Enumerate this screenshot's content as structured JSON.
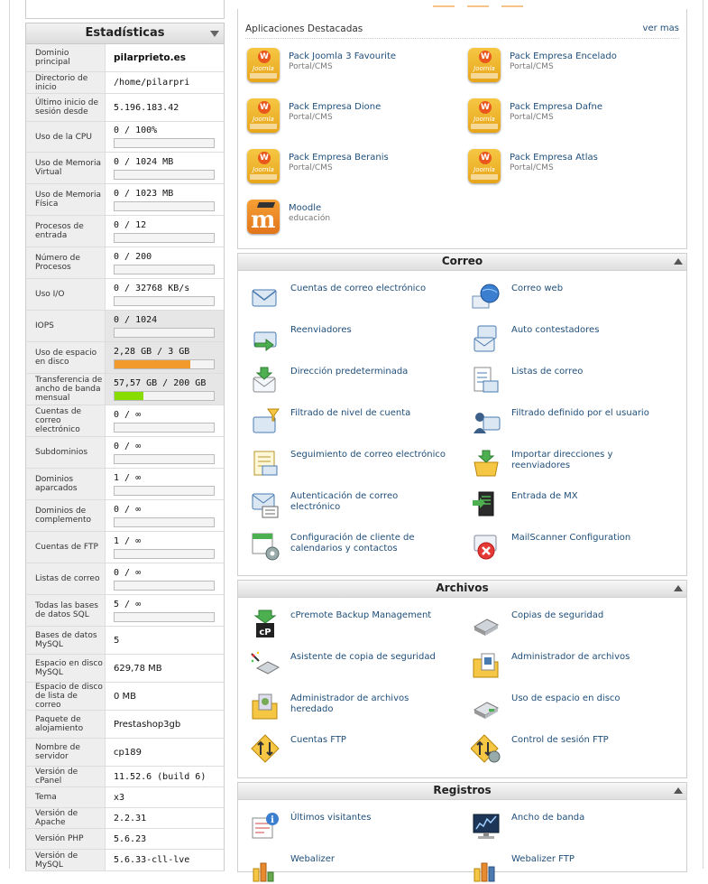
{
  "stats": {
    "title": "Estadísticas",
    "rows": [
      {
        "label": "Dominio principal",
        "value": "pilarprieto.es",
        "bold": true
      },
      {
        "label": "Directorio de inicio",
        "value": "/home/pilarpri"
      },
      {
        "label": "Último inicio de sesión desde",
        "value": "5.196.183.42"
      },
      {
        "label": "Uso de la CPU",
        "value": "0 / 100%",
        "bar": 0
      },
      {
        "label": "Uso de Memoria Virtual",
        "value": "0 / 1024 MB",
        "bar": 0
      },
      {
        "label": "Uso de Memoria Física",
        "value": "0 / 1023 MB",
        "bar": 0
      },
      {
        "label": "Procesos de entrada",
        "value": "0 / 12",
        "bar": 0
      },
      {
        "label": "Número de Procesos",
        "value": "0 / 200",
        "bar": 0
      },
      {
        "label": "Uso I/O",
        "value": "0 / 32768 KB/s",
        "bar": 0
      },
      {
        "label": "IOPS",
        "value": "0 / 1024",
        "bar": 0
      },
      {
        "label": "Uso de espacio en disco",
        "value": "2,28 GB / 3 GB",
        "bar": 0.76,
        "bar_color": "#f39a2c"
      },
      {
        "label": "Transferencia de ancho de banda mensual",
        "value": "57,57 GB / 200 GB",
        "bar": 0.29,
        "bar_color": "#88dd00"
      },
      {
        "label": "Cuentas de correo electrónico",
        "value": "0 / ∞",
        "bar": 0
      },
      {
        "label": "Subdominios",
        "value": "0 / ∞",
        "bar": 0
      },
      {
        "label": "Dominios aparcados",
        "value": "1 / ∞",
        "bar": 0
      },
      {
        "label": "Dominios de complemento",
        "value": "0 / ∞",
        "bar": 0
      },
      {
        "label": "Cuentas de FTP",
        "value": "1 / ∞",
        "bar": 0
      },
      {
        "label": "Listas de correo",
        "value": "0 / ∞",
        "bar": 0
      },
      {
        "label": "Todas las bases de datos SQL",
        "value": "5 / ∞",
        "bar": 0
      },
      {
        "label": "Bases de datos MySQL",
        "value": "5",
        "sans": true
      },
      {
        "label": "Espacio en disco MySQL",
        "value": "629,78 MB",
        "sans": true
      },
      {
        "label": "Espacio de disco de lista de correo",
        "value": "0 MB",
        "sans": true
      },
      {
        "label": "Paquete de alojamiento",
        "value": "Prestashop3gb",
        "sans": true
      },
      {
        "label": "Nombre de servidor",
        "value": "cp189",
        "sans": true
      },
      {
        "label": "Versión de cPanel",
        "value": "11.52.6 (build 6)"
      },
      {
        "label": "Tema",
        "value": "x3"
      },
      {
        "label": "Versión de Apache",
        "value": "2.2.31"
      },
      {
        "label": "Versión PHP",
        "value": "5.6.23"
      },
      {
        "label": "Versión de MySQL",
        "value": "5.6.33-cll-lve"
      }
    ]
  },
  "featured": {
    "title": "Aplicaciones Destacadas",
    "more": "ver mas",
    "joomla_badge": "W",
    "joomla_text": "Joomla",
    "moodle_letter": "m",
    "items": [
      {
        "name": "Pack Joomla 3 Favourite",
        "sub": "Portal/CMS",
        "icon": "joomla-pack-icon"
      },
      {
        "name": "Pack Empresa Encelado",
        "sub": "Portal/CMS",
        "icon": "joomla-pack-icon"
      },
      {
        "name": "Pack Empresa Dione",
        "sub": "Portal/CMS",
        "icon": "joomla-pack-icon"
      },
      {
        "name": "Pack Empresa Dafne",
        "sub": "Portal/CMS",
        "icon": "joomla-pack-icon"
      },
      {
        "name": "Pack Empresa Beranis",
        "sub": "Portal/CMS",
        "icon": "joomla-pack-icon"
      },
      {
        "name": "Pack Empresa Atlas",
        "sub": "Portal/CMS",
        "icon": "joomla-pack-icon"
      },
      {
        "name": "Moodle",
        "sub": "educación",
        "icon": "moodle-icon"
      }
    ]
  },
  "correo": {
    "title": "Correo",
    "items": [
      {
        "label": "Cuentas de correo electrónico",
        "icon": "envelope-icon"
      },
      {
        "label": "Correo web",
        "icon": "webmail-globe-icon"
      },
      {
        "label": "Reenviadores",
        "icon": "forward-mail-icon"
      },
      {
        "label": "Auto contestadores",
        "icon": "autoresponder-icon"
      },
      {
        "label": "Dirección predeterminada",
        "icon": "default-address-icon"
      },
      {
        "label": "Listas de correo",
        "icon": "mailing-list-icon"
      },
      {
        "label": "Filtrado de nivel de cuenta",
        "icon": "account-filter-icon"
      },
      {
        "label": "Filtrado definido por el usuario",
        "icon": "user-filter-icon"
      },
      {
        "label": "Seguimiento de correo electrónico",
        "icon": "email-trace-icon"
      },
      {
        "label": "Importar direcciones y reenviadores",
        "icon": "import-icon"
      },
      {
        "label": "Autenticación de correo electrónico",
        "icon": "email-auth-icon"
      },
      {
        "label": "Entrada de MX",
        "icon": "mx-entry-icon"
      },
      {
        "label": "Configuración de cliente de calendarios y contactos",
        "icon": "calendar-config-icon"
      },
      {
        "label": "MailScanner Configuration",
        "icon": "mailscanner-icon"
      }
    ]
  },
  "archivos": {
    "title": "Archivos",
    "items": [
      {
        "label": "cPremote Backup Management",
        "icon": "cpremote-backup-icon"
      },
      {
        "label": "Copias de seguridad",
        "icon": "backup-disk-icon"
      },
      {
        "label": "Asistente de copia de seguridad",
        "icon": "backup-wizard-icon"
      },
      {
        "label": "Administrador de archivos",
        "icon": "file-manager-icon"
      },
      {
        "label": "Administrador de archivos heredado",
        "icon": "legacy-file-manager-icon"
      },
      {
        "label": "Uso de espacio en disco",
        "icon": "disk-usage-icon"
      },
      {
        "label": "Cuentas FTP",
        "icon": "ftp-accounts-icon"
      },
      {
        "label": "Control de sesión FTP",
        "icon": "ftp-session-icon"
      }
    ]
  },
  "registros": {
    "title": "Registros",
    "items": [
      {
        "label": "Últimos visitantes",
        "icon": "latest-visitors-icon"
      },
      {
        "label": "Ancho de banda",
        "icon": "bandwidth-icon"
      },
      {
        "label": "Webalizer",
        "icon": "webalizer-icon"
      },
      {
        "label": "Webalizer FTP",
        "icon": "webalizer-ftp-icon"
      }
    ]
  },
  "colors": {
    "link": "#1f4e79",
    "disk_bar": "#f39a2c",
    "bandwidth_bar": "#88dd00"
  }
}
